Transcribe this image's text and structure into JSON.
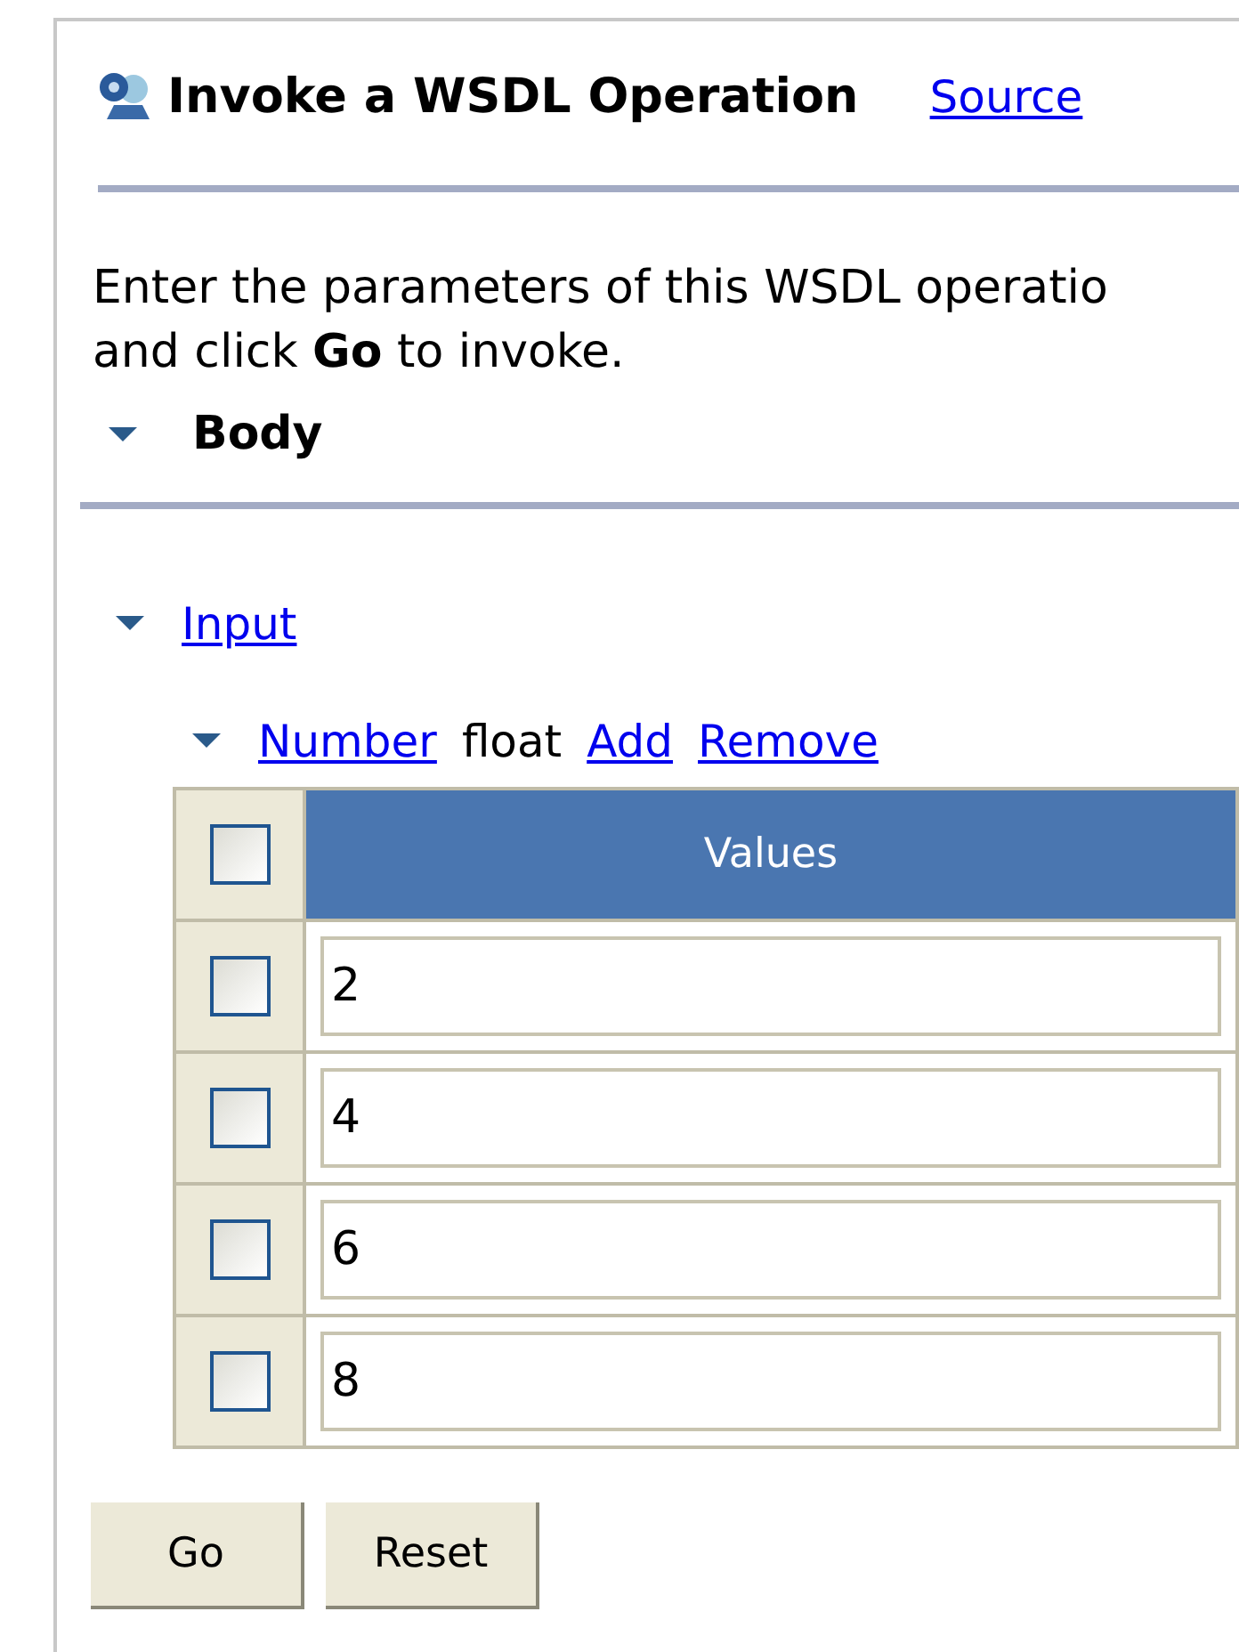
{
  "header": {
    "title": "Invoke a WSDL Operation",
    "link": "Source"
  },
  "instructions": "Enter the parameters of this WSDL operatio\nand click **Go** to invoke.",
  "body_section": {
    "label": "Body",
    "expanded": true
  },
  "input_section": {
    "label": "Input",
    "expanded": true
  },
  "parameter": {
    "name": "Number",
    "type": "float",
    "expanded": true,
    "actions": [
      "Add",
      "Remove"
    ]
  },
  "table": {
    "header_checked": false,
    "column": "Values",
    "rows": [
      {
        "checked": false,
        "value": "2"
      },
      {
        "checked": false,
        "value": "4"
      },
      {
        "checked": false,
        "value": "6"
      },
      {
        "checked": false,
        "value": "8"
      }
    ]
  },
  "buttons": [
    "Go",
    "Reset"
  ]
}
